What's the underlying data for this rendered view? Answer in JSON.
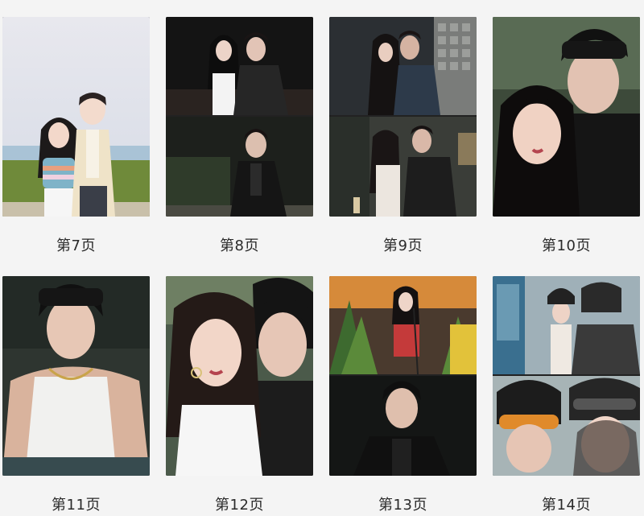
{
  "pages": [
    {
      "label": "第7页",
      "photo": "two-person-photo"
    },
    {
      "label": "第8页",
      "photo": "two-panel-photo"
    },
    {
      "label": "第9页",
      "photo": "two-panel-photo"
    },
    {
      "label": "第10页",
      "photo": "two-person-closeup-photo"
    },
    {
      "label": "第11页",
      "photo": "single-person-photo"
    },
    {
      "label": "第12页",
      "photo": "two-person-closeup-photo"
    },
    {
      "label": "第13页",
      "photo": "two-panel-photo"
    },
    {
      "label": "第14页",
      "photo": "two-panel-photo"
    }
  ]
}
